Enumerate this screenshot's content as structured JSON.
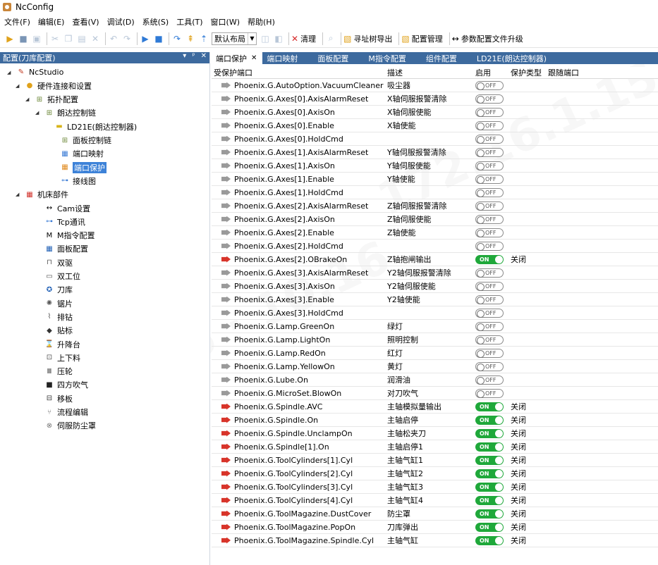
{
  "window": {
    "title": "NcConfig"
  },
  "menu": [
    "文件(F)",
    "编辑(E)",
    "查看(V)",
    "调试(D)",
    "系统(S)",
    "工具(T)",
    "窗口(W)",
    "帮助(H)"
  ],
  "toolbar": {
    "layout_combo": "默认布局",
    "clear_label": "清理",
    "export_label": "寻址树导出",
    "config_manage_label": "配置管理",
    "upgrade_label": "参数配置文件升级"
  },
  "left_panel": {
    "title": "配置(刀库配置)",
    "header_buttons": [
      "▾",
      "ᵖ",
      "✕"
    ],
    "tree": [
      {
        "label": "NcStudio",
        "expander": "◢",
        "icon": "ncstudio-icon",
        "glyph": "✎",
        "color": "#c23b22"
      },
      {
        "label": "硬件连接和设置",
        "expander": "◢",
        "icon": "hardware-icon",
        "glyph": "●",
        "color": "#e0a21b"
      },
      {
        "label": "拓扑配置",
        "expander": "◢",
        "icon": "topology-icon",
        "glyph": "⊞",
        "color": "#6f8a3c"
      },
      {
        "label": "朗达控制链",
        "expander": "◢",
        "icon": "chain-icon",
        "glyph": "⊞",
        "color": "#6f8a3c"
      },
      {
        "label": "LD21E(朗达控制器)",
        "expander": "",
        "icon": "controller-icon",
        "glyph": "▬",
        "color": "#d8b41a"
      },
      {
        "label": "面板控制链",
        "expander": "",
        "icon": "panel-chain-icon",
        "glyph": "⊞",
        "color": "#6f8a3c"
      },
      {
        "label": "端口映射",
        "expander": "",
        "icon": "port-map-icon",
        "glyph": "▦",
        "color": "#3a7bd5"
      },
      {
        "label": "端口保护",
        "expander": "",
        "icon": "port-protect-icon",
        "glyph": "▦",
        "color": "#e08a1e",
        "selected": true
      },
      {
        "label": "接线图",
        "expander": "",
        "icon": "wiring-icon",
        "glyph": "⊶",
        "color": "#3a7bd5"
      },
      {
        "label": "机床部件",
        "expander": "◢",
        "icon": "machine-parts-icon",
        "glyph": "▦",
        "color": "#d0302a"
      },
      {
        "label": "Cam设置",
        "expander": "",
        "icon": "cam-icon",
        "glyph": "↔",
        "color": "#000"
      },
      {
        "label": "Tcp通讯",
        "expander": "",
        "icon": "tcp-icon",
        "glyph": "⊶",
        "color": "#3a7bd5"
      },
      {
        "label": "M指令配置",
        "expander": "",
        "icon": "m-command-icon",
        "glyph": "M",
        "color": "#000"
      },
      {
        "label": "面板配置",
        "expander": "",
        "icon": "panel-config-icon",
        "glyph": "▦",
        "color": "#1f5fb5"
      },
      {
        "label": "双驱",
        "expander": "",
        "icon": "dual-drive-icon",
        "glyph": "⊓",
        "color": "#555"
      },
      {
        "label": "双工位",
        "expander": "",
        "icon": "dual-station-icon",
        "glyph": "▭",
        "color": "#555"
      },
      {
        "label": "刀库",
        "expander": "",
        "icon": "tool-magazine-icon",
        "glyph": "✪",
        "color": "#1f5fb5"
      },
      {
        "label": "锯片",
        "expander": "",
        "icon": "saw-blade-icon",
        "glyph": "✺",
        "color": "#555"
      },
      {
        "label": "排钻",
        "expander": "",
        "icon": "row-drill-icon",
        "glyph": "⌇",
        "color": "#555"
      },
      {
        "label": "贴标",
        "expander": "",
        "icon": "label-icon",
        "glyph": "◆",
        "color": "#333"
      },
      {
        "label": "升降台",
        "expander": "",
        "icon": "lift-table-icon",
        "glyph": "⌛",
        "color": "#333"
      },
      {
        "label": "上下料",
        "expander": "",
        "icon": "loading-icon",
        "glyph": "⊡",
        "color": "#555"
      },
      {
        "label": "压轮",
        "expander": "",
        "icon": "pressure-wheel-icon",
        "glyph": "Ⅲ",
        "color": "#333"
      },
      {
        "label": "四方吹气",
        "expander": "",
        "icon": "air-blow-icon",
        "glyph": "■",
        "color": "#222"
      },
      {
        "label": "移板",
        "expander": "",
        "icon": "move-board-icon",
        "glyph": "⊟",
        "color": "#333"
      },
      {
        "label": "流程编辑",
        "expander": "",
        "icon": "flow-edit-icon",
        "glyph": "⑂",
        "color": "#777"
      },
      {
        "label": "伺服防尘罩",
        "expander": "",
        "icon": "servo-cover-icon",
        "glyph": "⊗",
        "color": "#777"
      }
    ]
  },
  "tabs": [
    {
      "label": "端口保护",
      "active": true,
      "close": "✕"
    },
    {
      "label": "端口映射"
    },
    {
      "label": "面板配置"
    },
    {
      "label": "M指令配置"
    },
    {
      "label": "组件配置"
    },
    {
      "label": "LD21E(朗达控制器)"
    }
  ],
  "grid": {
    "columns": [
      "受保护端口",
      "描述",
      "启用",
      "保护类型",
      "跟随端口"
    ],
    "on_text": "ON",
    "off_text": "OFF",
    "rows": [
      {
        "port": "Phoenix.G.AutoOption.VacuumCleaner",
        "desc": "吸尘器",
        "on": false,
        "ptype": ""
      },
      {
        "port": "Phoenix.G.Axes[0].AxisAlarmReset",
        "desc": "X轴伺服报警清除",
        "on": false,
        "ptype": ""
      },
      {
        "port": "Phoenix.G.Axes[0].AxisOn",
        "desc": "X轴伺服使能",
        "on": false,
        "ptype": ""
      },
      {
        "port": "Phoenix.G.Axes[0].Enable",
        "desc": "X轴使能",
        "on": false,
        "ptype": ""
      },
      {
        "port": "Phoenix.G.Axes[0].HoldCmd",
        "desc": "",
        "on": false,
        "ptype": ""
      },
      {
        "port": "Phoenix.G.Axes[1].AxisAlarmReset",
        "desc": "Y轴伺服报警清除",
        "on": false,
        "ptype": ""
      },
      {
        "port": "Phoenix.G.Axes[1].AxisOn",
        "desc": "Y轴伺服使能",
        "on": false,
        "ptype": ""
      },
      {
        "port": "Phoenix.G.Axes[1].Enable",
        "desc": "Y轴使能",
        "on": false,
        "ptype": ""
      },
      {
        "port": "Phoenix.G.Axes[1].HoldCmd",
        "desc": "",
        "on": false,
        "ptype": ""
      },
      {
        "port": "Phoenix.G.Axes[2].AxisAlarmReset",
        "desc": "Z轴伺服报警清除",
        "on": false,
        "ptype": ""
      },
      {
        "port": "Phoenix.G.Axes[2].AxisOn",
        "desc": "Z轴伺服使能",
        "on": false,
        "ptype": ""
      },
      {
        "port": "Phoenix.G.Axes[2].Enable",
        "desc": "Z轴使能",
        "on": false,
        "ptype": ""
      },
      {
        "port": "Phoenix.G.Axes[2].HoldCmd",
        "desc": "",
        "on": false,
        "ptype": ""
      },
      {
        "port": "Phoenix.G.Axes[2].OBrakeOn",
        "desc": "Z轴抱闸输出",
        "on": true,
        "ptype": "关闭"
      },
      {
        "port": "Phoenix.G.Axes[3].AxisAlarmReset",
        "desc": "Y2轴伺服报警清除",
        "on": false,
        "ptype": ""
      },
      {
        "port": "Phoenix.G.Axes[3].AxisOn",
        "desc": "Y2轴伺服使能",
        "on": false,
        "ptype": ""
      },
      {
        "port": "Phoenix.G.Axes[3].Enable",
        "desc": "Y2轴使能",
        "on": false,
        "ptype": ""
      },
      {
        "port": "Phoenix.G.Axes[3].HoldCmd",
        "desc": "",
        "on": false,
        "ptype": ""
      },
      {
        "port": "Phoenix.G.Lamp.GreenOn",
        "desc": "绿灯",
        "on": false,
        "ptype": ""
      },
      {
        "port": "Phoenix.G.Lamp.LightOn",
        "desc": "照明控制",
        "on": false,
        "ptype": ""
      },
      {
        "port": "Phoenix.G.Lamp.RedOn",
        "desc": "红灯",
        "on": false,
        "ptype": ""
      },
      {
        "port": "Phoenix.G.Lamp.YellowOn",
        "desc": "黄灯",
        "on": false,
        "ptype": ""
      },
      {
        "port": "Phoenix.G.Lube.On",
        "desc": "润滑油",
        "on": false,
        "ptype": ""
      },
      {
        "port": "Phoenix.G.MicroSet.BlowOn",
        "desc": "对刀吹气",
        "on": false,
        "ptype": ""
      },
      {
        "port": "Phoenix.G.Spindle.AVC",
        "desc": "主轴模拟量输出",
        "on": true,
        "ptype": "关闭"
      },
      {
        "port": "Phoenix.G.Spindle.On",
        "desc": "主轴启停",
        "on": true,
        "ptype": "关闭"
      },
      {
        "port": "Phoenix.G.Spindle.UnclampOn",
        "desc": "主轴松夹刀",
        "on": true,
        "ptype": "关闭"
      },
      {
        "port": "Phoenix.G.Spindle[1].On",
        "desc": "主轴启停1",
        "on": true,
        "ptype": "关闭"
      },
      {
        "port": "Phoenix.G.ToolCylinders[1].Cyl",
        "desc": "主轴气缸1",
        "on": true,
        "ptype": "关闭"
      },
      {
        "port": "Phoenix.G.ToolCylinders[2].Cyl",
        "desc": "主轴气缸2",
        "on": true,
        "ptype": "关闭"
      },
      {
        "port": "Phoenix.G.ToolCylinders[3].Cyl",
        "desc": "主轴气缸3",
        "on": true,
        "ptype": "关闭"
      },
      {
        "port": "Phoenix.G.ToolCylinders[4].Cyl",
        "desc": "主轴气缸4",
        "on": true,
        "ptype": "关闭"
      },
      {
        "port": "Phoenix.G.ToolMagazine.DustCover",
        "desc": "防尘罩",
        "on": true,
        "ptype": "关闭"
      },
      {
        "port": "Phoenix.G.ToolMagazine.PopOn",
        "desc": "刀库弹出",
        "on": true,
        "ptype": "关闭"
      },
      {
        "port": "Phoenix.G.ToolMagazine.Spindle.Cyl",
        "desc": "主轴气缸",
        "on": true,
        "ptype": "关闭"
      }
    ]
  },
  "colors": {
    "panel_header_bg": "#3d6a9e",
    "selection_bg": "#3d82d8",
    "toggle_on": "#1fa83a",
    "plug_on": "#d8342a",
    "plug_off": "#9a9a9a"
  }
}
